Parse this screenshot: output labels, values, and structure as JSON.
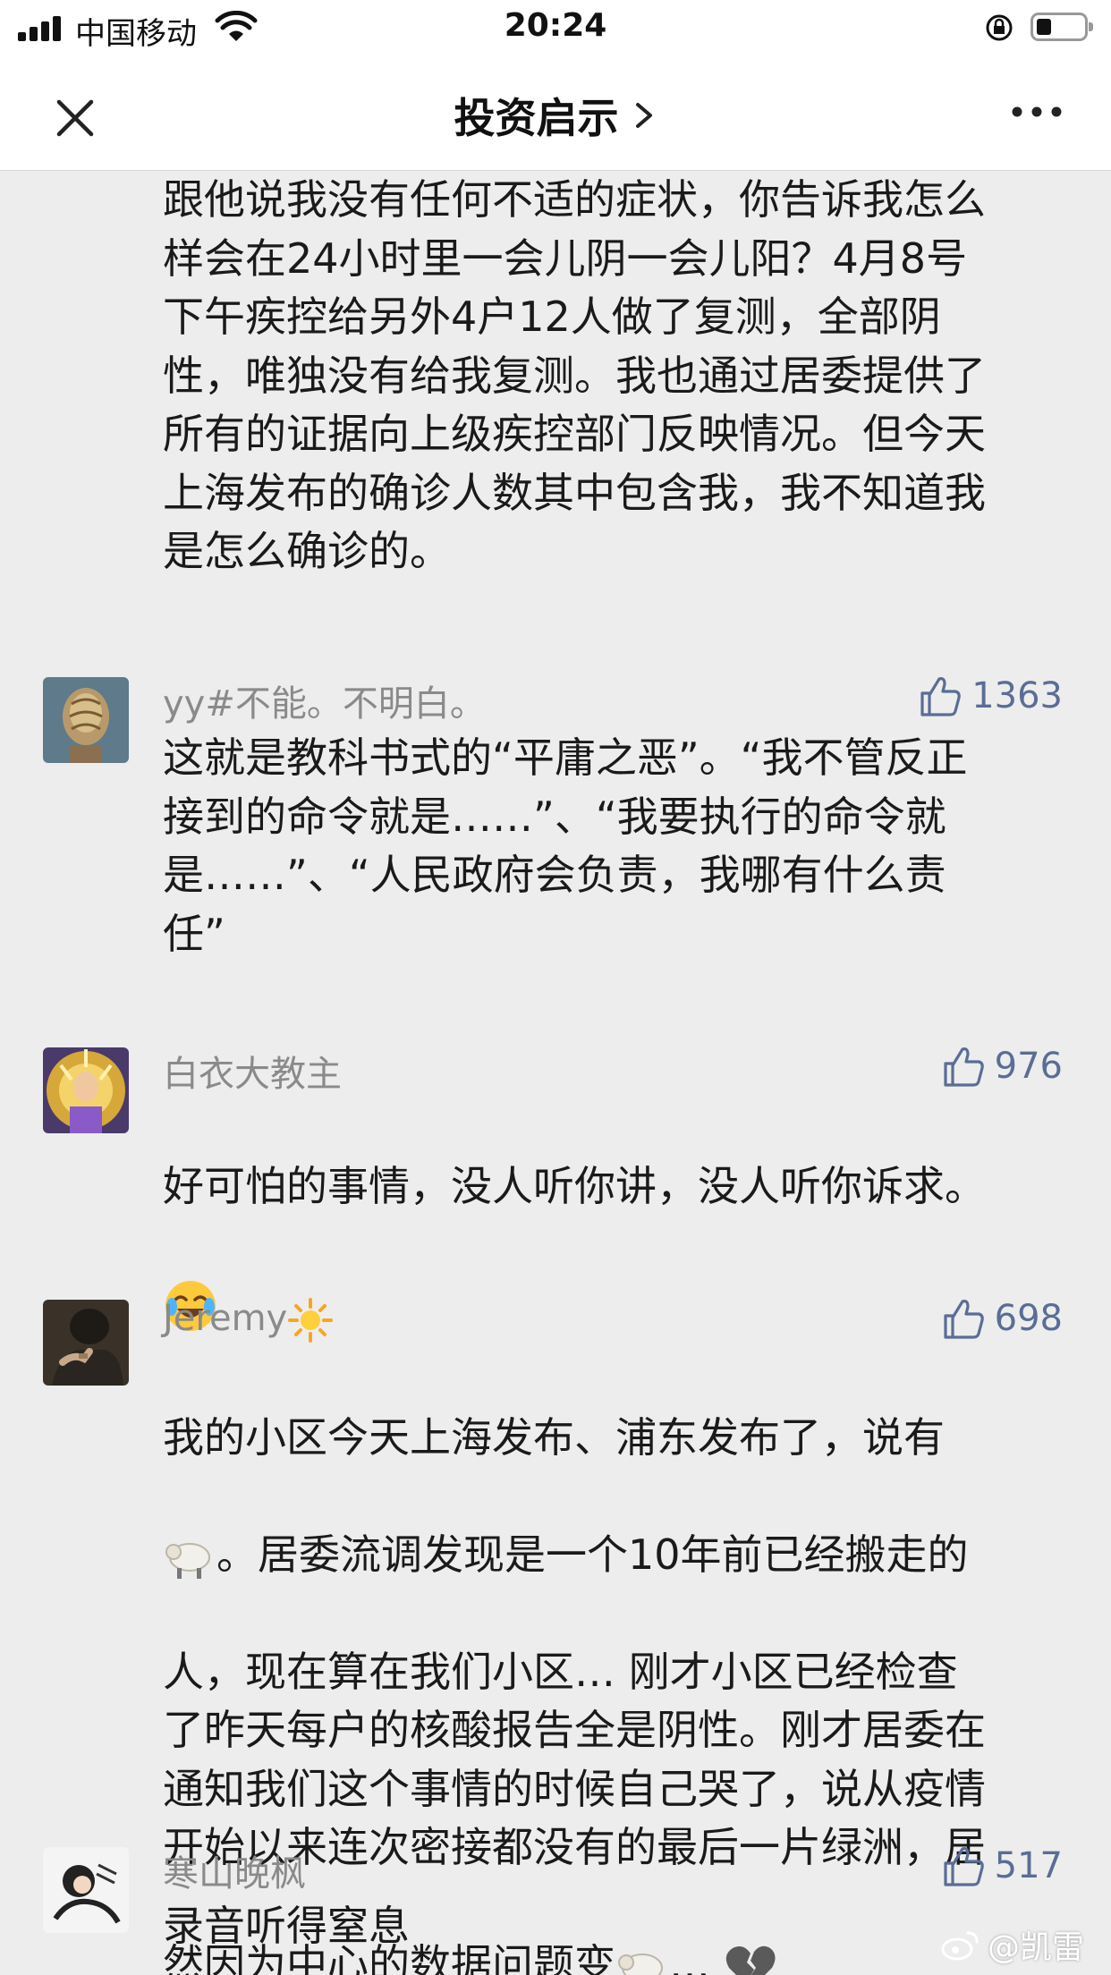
{
  "status_bar": {
    "carrier": "中国移动",
    "time": "20:24"
  },
  "nav": {
    "title": "投资启示"
  },
  "article_tail": {
    "text": "跟他说我没有任何不适的症状，你告诉我怎么\n样会在24小时里一会儿阴一会儿阳？4月8号\n下午疾控给另外4户12人做了复测，全部阴\n性，唯独没有给我复测。我也通过居委提供了\n所有的证据向上级疾控部门反映情况。但今天\n上海发布的确诊人数其中包含我，我不知道我\n是怎么确诊的。"
  },
  "comments": [
    {
      "username": "yy#不能。不明白。",
      "likes": "1363",
      "text": "这就是教科书式的“平庸之恶”。“我不管反正\n接到的命令就是……”、“我要执行的命令就\n是……”、“人民政府会负责，我哪有什么责\n任”"
    },
    {
      "username": "白衣大教主",
      "likes": "976",
      "text": "好可怕的事情，没人听你讲，没人听你诉求。"
    },
    {
      "username": "Jeremy",
      "likes": "698",
      "text_line1": "我的小区今天上海发布、浦东发布了，说有",
      "text_line2_after": "。居委流调发现是一个10年前已经搬走的",
      "text_rest": "人，现在算在我们小区… 刚才小区已经检查\n了昨天每户的核酸报告全是阴性。刚才居委在\n通知我们这个事情的时候自己哭了，说从疫情\n开始以来连次密接都没有的最后一片绿洲，居",
      "text_last_before": "然因为中心的数据问题变",
      "text_last_after": "…"
    },
    {
      "username": "寒山晚枫",
      "likes": "517",
      "text": "录音听得窒息"
    }
  ],
  "watermark": "@凯雷",
  "icons": {
    "close": "close-icon",
    "chevron": "chevron-right-icon",
    "more": "more-dots-icon",
    "like": "thumbs-up-icon",
    "emoji_cry": "crying-laughing-emoji-icon",
    "emoji_sun": "sun-emoji-icon",
    "emoji_sheep": "sheep-emoji-icon",
    "emoji_broken_heart": "broken-heart-emoji-icon",
    "weibo": "weibo-logo-icon"
  },
  "colors": {
    "background": "#ededed",
    "username": "#8a8a8a",
    "likes": "#5a6d95",
    "text": "#1a1a1a"
  }
}
